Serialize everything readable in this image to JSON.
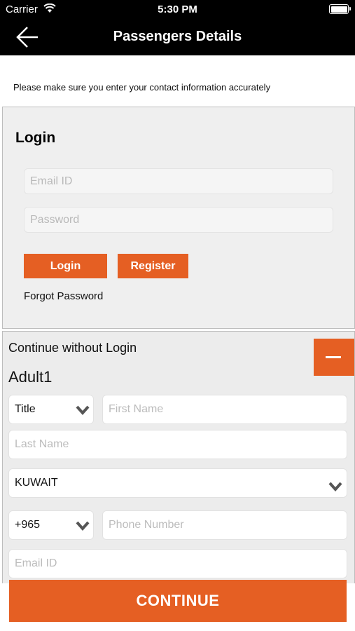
{
  "status_bar": {
    "carrier": "Carrier",
    "time": "5:30 PM"
  },
  "nav": {
    "title": "Passengers Details",
    "back_icon": "arrow-left-icon"
  },
  "notice": "Please make sure you enter your contact information accurately",
  "login": {
    "heading": "Login",
    "email_placeholder": "Email ID",
    "password_placeholder": "Password",
    "login_label": "Login",
    "register_label": "Register",
    "forgot_label": "Forgot Password"
  },
  "guest": {
    "heading": "Continue without Login",
    "collapse_icon": "minus-icon",
    "passenger_label": "Adult1",
    "title_value": "Title",
    "first_name_placeholder": "First Name",
    "last_name_placeholder": "Last Name",
    "country_value": "KUWAIT",
    "country_code_value": "+965",
    "phone_placeholder": "Phone Number",
    "email_placeholder": "Email ID"
  },
  "continue_label": "CONTINUE",
  "colors": {
    "accent": "#e55f23",
    "header": "#000000",
    "panel": "#efefef"
  }
}
